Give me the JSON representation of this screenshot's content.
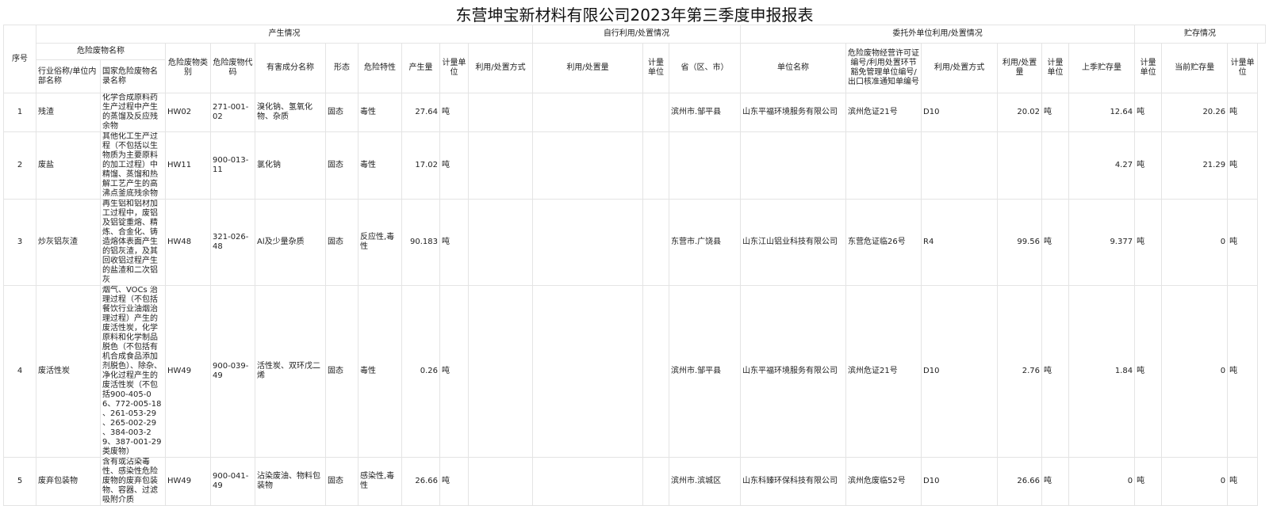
{
  "title": "东营坤宝新材料有限公司2023年第三季度申报报表",
  "headers": {
    "seq": "序号",
    "production": "产生情况",
    "self": "自行利用/处置情况",
    "entrusted": "委托外单位利用/处置情况",
    "storage": "贮存情况",
    "waste_name": "危险废物名称",
    "industry_name": "行业俗称/单位内部名称",
    "national_name": "国家危险废物名录名称",
    "category": "危险废物类别",
    "code": "危险废物代码",
    "harmful": "有害成分名称",
    "form": "形态",
    "hazard": "危险特性",
    "amount": "产生量",
    "unit": "计量单位",
    "self_method": "利用/处置方式",
    "self_amount": "利用/处置量",
    "self_unit": "计量单位",
    "province": "省（区、市）",
    "company": "单位名称",
    "license": "危险废物经营许可证编号/利用处置环节豁免管理单位编号/出口核准通知单编号",
    "ent_method": "利用/处置方式",
    "ent_amount": "利用/处置量",
    "ent_unit": "计量单位",
    "last_storage": "上季贮存量",
    "last_unit": "计量单位",
    "current_storage": "当前贮存量",
    "current_unit": "计量单位"
  },
  "rows": [
    {
      "seq": "1",
      "industry_name": "残渣",
      "national_name": "化学合成原料药生产过程中产生的蒸馏及反应残余物",
      "category": "HW02",
      "code": "271-001-02",
      "harmful": "溴化钠、氢氧化物、杂质",
      "form": "固态",
      "hazard": "毒性",
      "amount": "27.64",
      "unit": "吨",
      "self_method": "",
      "self_amount": "",
      "self_unit": "",
      "province": "滨州市.邹平县",
      "company": "山东平福环境服务有限公司",
      "license": "滨州危证21号",
      "ent_method": "D10",
      "ent_amount": "20.02",
      "ent_unit": "吨",
      "last_storage": "12.64",
      "last_unit": "吨",
      "current_storage": "20.26",
      "current_unit": "吨"
    },
    {
      "seq": "2",
      "industry_name": "废盐",
      "national_name": "其他化工生产过程（不包括以生物质为主要原料的加工过程）中精馏、蒸馏和热解工艺产生的高沸点釜底残余物",
      "category": "HW11",
      "code": "900-013-11",
      "harmful": "氯化钠",
      "form": "固态",
      "hazard": "毒性",
      "amount": "17.02",
      "unit": "吨",
      "self_method": "",
      "self_amount": "",
      "self_unit": "",
      "province": "",
      "company": "",
      "license": "",
      "ent_method": "",
      "ent_amount": "",
      "ent_unit": "",
      "last_storage": "4.27",
      "last_unit": "吨",
      "current_storage": "21.29",
      "current_unit": "吨"
    },
    {
      "seq": "3",
      "industry_name": "炒灰铝灰渣",
      "national_name": "再生铝和铝材加工过程中，废铝及铝锭重熔、精炼、合金化、铸造熔体表面产生的铝灰渣，及其回收铝过程产生的盐渣和二次铝灰",
      "category": "HW48",
      "code": "321-026-48",
      "harmful": "Al及少量杂质",
      "form": "固态",
      "hazard": "反应性,毒性",
      "amount": "90.183",
      "unit": "吨",
      "self_method": "",
      "self_amount": "",
      "self_unit": "",
      "province": "东营市.广饶县",
      "company": "山东江山铝业科技有限公司",
      "license": "东营危证临26号",
      "ent_method": "R4",
      "ent_amount": "99.56",
      "ent_unit": "吨",
      "last_storage": "9.377",
      "last_unit": "吨",
      "current_storage": "0",
      "current_unit": "吨"
    },
    {
      "seq": "4",
      "industry_name": "废活性炭",
      "national_name": "烟气、VOCs 治理过程（不包括餐饮行业油烟治理过程）产生的废活性炭，化学原料和化学制品脱色（不包括有机合成食品添加剂脱色）、除杂、净化过程产生的废活性炭（不包括900-405-06、772-005-18 、261-053-29 、265-002-29 、384-003-29、387-001-29 类废物）",
      "category": "HW49",
      "code": "900-039-49",
      "harmful": "活性炭、双环戊二烯",
      "form": "固态",
      "hazard": "毒性",
      "amount": "0.26",
      "unit": "吨",
      "self_method": "",
      "self_amount": "",
      "self_unit": "",
      "province": "滨州市.邹平县",
      "company": "山东平福环境服务有限公司",
      "license": "滨州危证21号",
      "ent_method": "D10",
      "ent_amount": "2.76",
      "ent_unit": "吨",
      "last_storage": "1.84",
      "last_unit": "吨",
      "current_storage": "0",
      "current_unit": "吨"
    },
    {
      "seq": "5",
      "industry_name": "废弃包装物",
      "national_name": "含有或沾染毒性、感染性危险废物的废弃包装物、容器、过滤吸附介质",
      "category": "HW49",
      "code": "900-041-49",
      "harmful": "沾染废油、物料包装物",
      "form": "固态",
      "hazard": "感染性,毒性",
      "amount": "26.66",
      "unit": "吨",
      "self_method": "",
      "self_amount": "",
      "self_unit": "",
      "province": "滨州市.滨城区",
      "company": "山东科臻环保科技有限公司",
      "license": "滨州危废临52号",
      "ent_method": "D10",
      "ent_amount": "26.66",
      "ent_unit": "吨",
      "last_storage": "0",
      "last_unit": "吨",
      "current_storage": "0",
      "current_unit": "吨"
    }
  ]
}
